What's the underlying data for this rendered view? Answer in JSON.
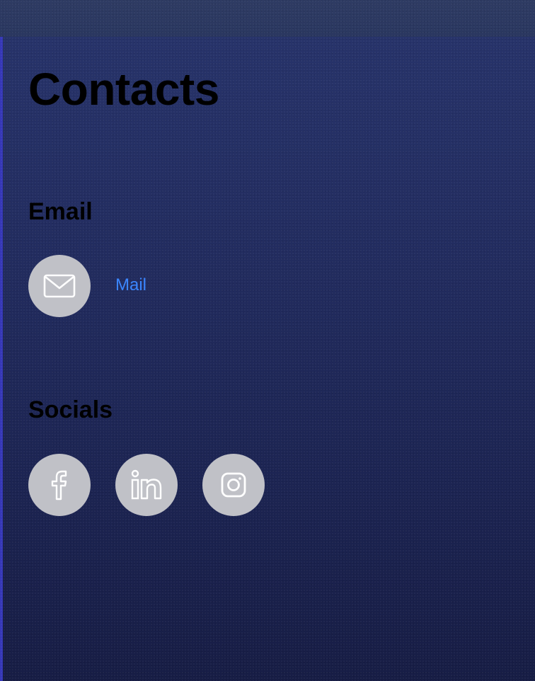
{
  "page": {
    "title": "Contacts"
  },
  "email": {
    "heading": "Email",
    "icon": "mail-icon",
    "link_label": "Mail"
  },
  "socials": {
    "heading": "Socials",
    "items": [
      {
        "icon": "facebook-icon"
      },
      {
        "icon": "linkedin-icon"
      },
      {
        "icon": "instagram-icon"
      }
    ]
  },
  "colors": {
    "panel_background": "#222c5f",
    "topbar_background": "#2e3b63",
    "panel_edge": "#3638b8",
    "icon_circle": "#c0c1c7",
    "icon_glyph": "#ffffff",
    "link": "#3b86ff",
    "heading_text": "#000000"
  }
}
